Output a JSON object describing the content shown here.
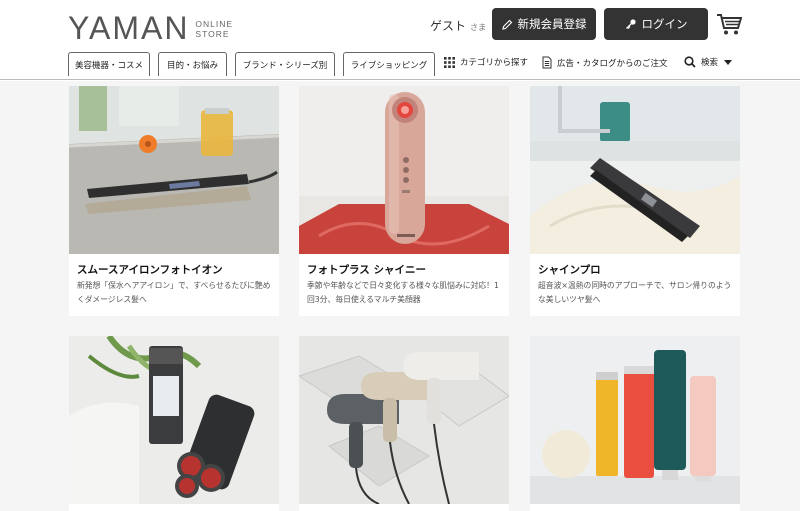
{
  "header": {
    "logo_main": "YAMAN",
    "logo_sub_1": "ONLINE",
    "logo_sub_2": "STORE",
    "guest": "ゲスト",
    "guest_suffix": "さま",
    "register_label": "新規会員登録",
    "login_label": "ログイン"
  },
  "nav": {
    "tabs": [
      "美容機器・コスメ",
      "目的・お悩み",
      "ブランド・シリーズ別",
      "ライブショッピング"
    ],
    "category_label": "カテゴリから探す",
    "ad_label": "広告・カタログからのご注文",
    "search_label": "検索"
  },
  "products": [
    {
      "title": "スムースアイロンフォトイオン",
      "desc": "新発想「保水ヘアアイロン」で、すべらせるたびに艶めくダメージレス髪へ"
    },
    {
      "title": "フォトプラス シャイニー",
      "desc": "季節や年齢などで日々変化する様々な肌悩みに対応！1回3分、毎日使えるマルチ美顔器"
    },
    {
      "title": "シャインプロ",
      "desc": "超音波×温熱の同時のアプローチで、サロン帰りのような美しいツヤ髪へ"
    },
    {
      "title": "",
      "desc": ""
    },
    {
      "title": "",
      "desc": ""
    },
    {
      "title": "",
      "desc": ""
    }
  ],
  "colors": {
    "button_dark": "#333333",
    "background_gray": "#f5f5f5",
    "device_pink": "#d8a79a"
  }
}
